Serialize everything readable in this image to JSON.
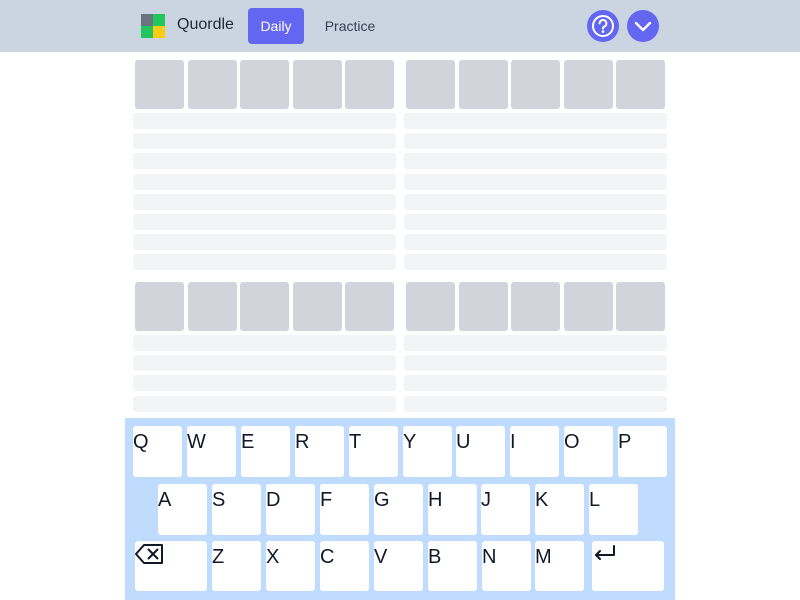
{
  "app": {
    "title": "Quordle"
  },
  "nav": {
    "tabs": [
      {
        "label": "Daily",
        "active": true
      },
      {
        "label": "Practice",
        "active": false
      }
    ]
  },
  "icons": {
    "help": "help-circle-icon",
    "menu": "chevron-down-icon",
    "backspace": "backspace-icon",
    "enter": "enter-icon"
  },
  "colors": {
    "accent": "#6366f1",
    "header": "#cbd5e1",
    "keyboard": "#bfdbfe",
    "tile": "#d1d5db",
    "row": "#f3f4f6",
    "logo": [
      "#6b7280",
      "#22c55e",
      "#22c55e",
      "#facc15"
    ]
  },
  "keyboard": {
    "rows": [
      [
        "Q",
        "W",
        "E",
        "R",
        "T",
        "Y",
        "U",
        "I",
        "O",
        "P"
      ],
      [
        "A",
        "S",
        "D",
        "F",
        "G",
        "H",
        "J",
        "K",
        "L"
      ],
      [
        "Z",
        "X",
        "C",
        "V",
        "B",
        "N",
        "M"
      ]
    ]
  }
}
